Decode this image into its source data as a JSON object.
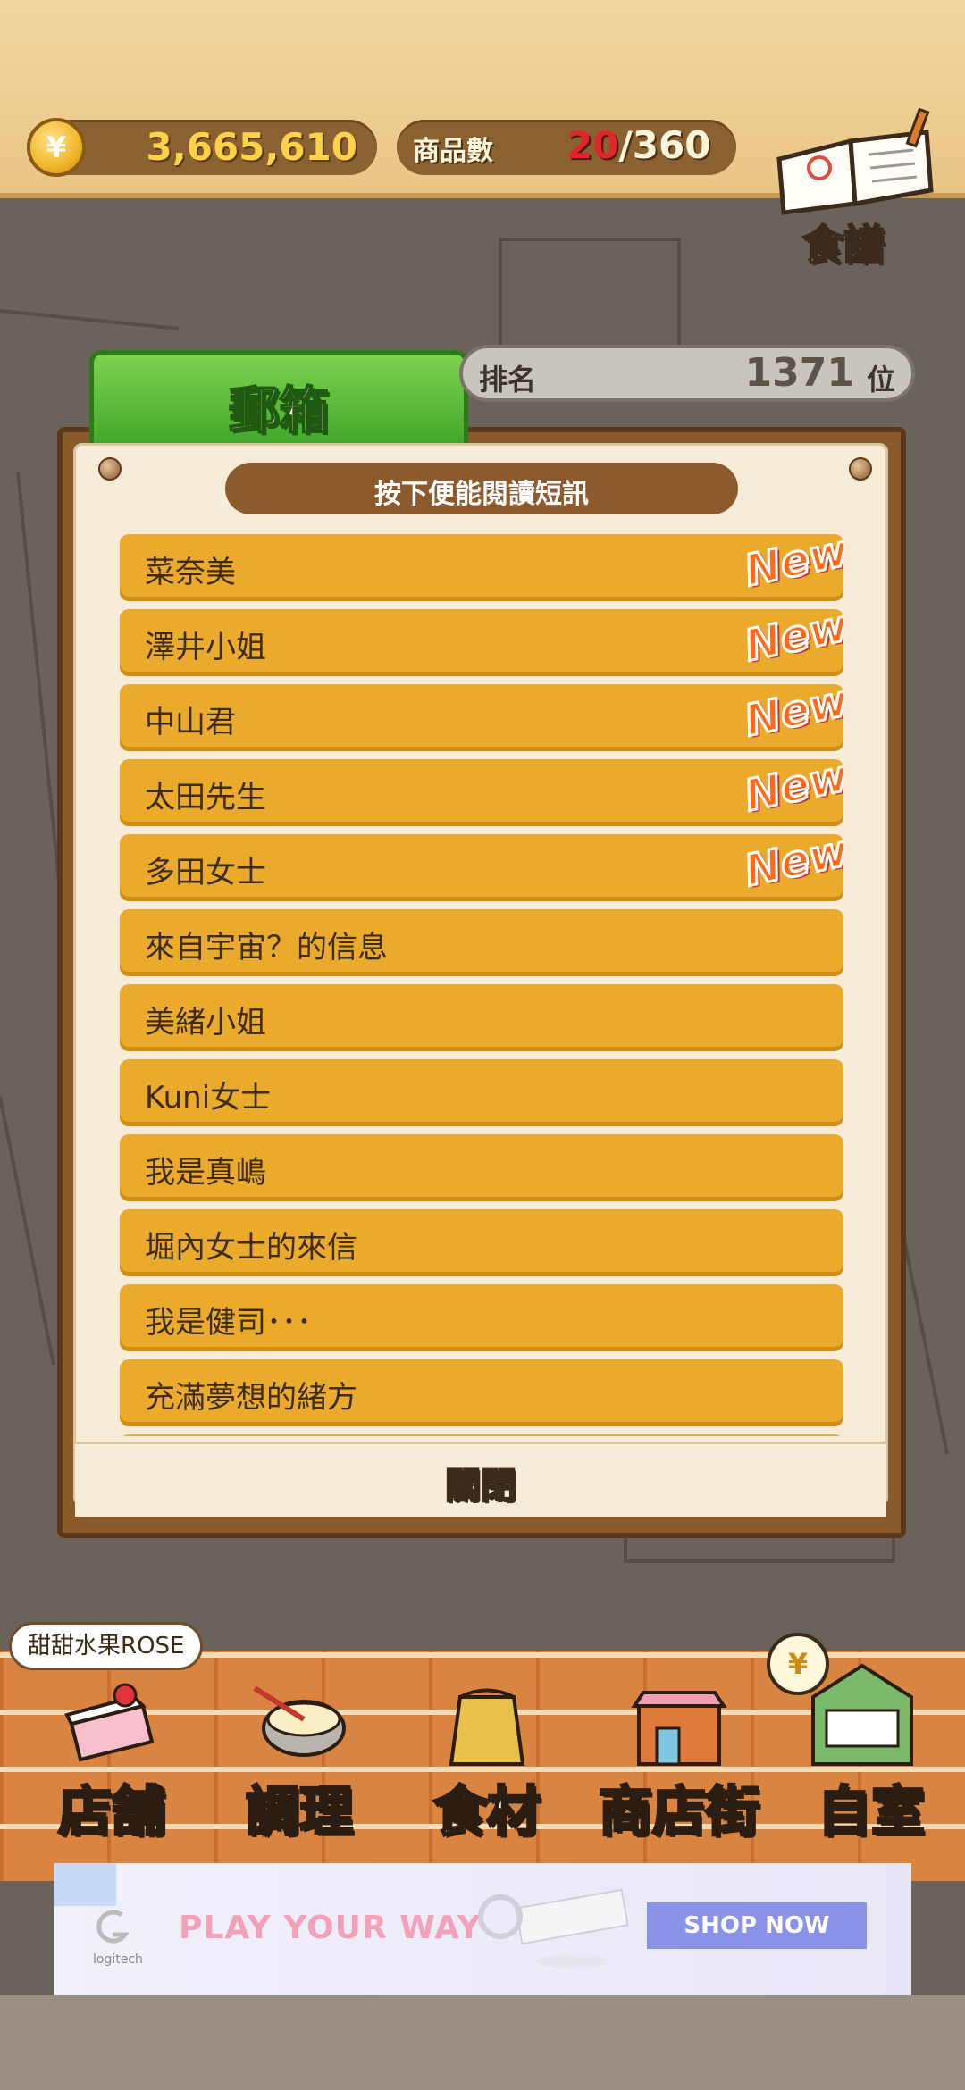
{
  "header": {
    "money": "3,665,610",
    "coin_symbol": "¥",
    "items_label": "商品數",
    "items_current": "20",
    "items_separator": "/",
    "items_total": "360",
    "recipe_label": "食譜"
  },
  "mailbox": {
    "tab_title": "郵箱",
    "rank_label": "排名",
    "rank_value": "1371",
    "rank_unit": "位",
    "instruction": "按下便能閱讀短訊",
    "new_label": "New",
    "items": [
      {
        "name": "菜奈美",
        "is_new": true
      },
      {
        "name": "澤井小姐",
        "is_new": true
      },
      {
        "name": "中山君",
        "is_new": true
      },
      {
        "name": "太田先生",
        "is_new": true
      },
      {
        "name": "多田女士",
        "is_new": true
      },
      {
        "name": "來自宇宙？的信息",
        "is_new": false
      },
      {
        "name": "美緒小姐",
        "is_new": false
      },
      {
        "name": "Kuni女士",
        "is_new": false
      },
      {
        "name": "我是真嶋",
        "is_new": false
      },
      {
        "name": "堀內女士的來信",
        "is_new": false
      },
      {
        "name": "我是健司･･･",
        "is_new": false
      },
      {
        "name": "充滿夢想的緒方",
        "is_new": false
      }
    ],
    "close_label": "關閉"
  },
  "bottom_nav": {
    "shop_name": "甜甜水果ROSE",
    "items": [
      {
        "label": "店舖",
        "icon": "cake-icon"
      },
      {
        "label": "調理",
        "icon": "mixing-bowl-icon"
      },
      {
        "label": "食材",
        "icon": "flour-sack-icon"
      },
      {
        "label": "商店街",
        "icon": "shop-icon"
      },
      {
        "label": "自室",
        "icon": "staff-only-door-icon"
      }
    ],
    "home_coin_symbol": "¥"
  },
  "ad": {
    "brand": "logitech",
    "slogan": "PLAY YOUR WAY",
    "button": "SHOP NOW"
  },
  "colors": {
    "header_bg": "#f3d8a3",
    "pill_bg": "#8a6231",
    "mail_item": "#eaaa2c",
    "tab_green": "#3fa52a",
    "new_orange": "#ff6a1a",
    "board_brown": "#8a5a2b",
    "paper": "#f6ecd8"
  }
}
